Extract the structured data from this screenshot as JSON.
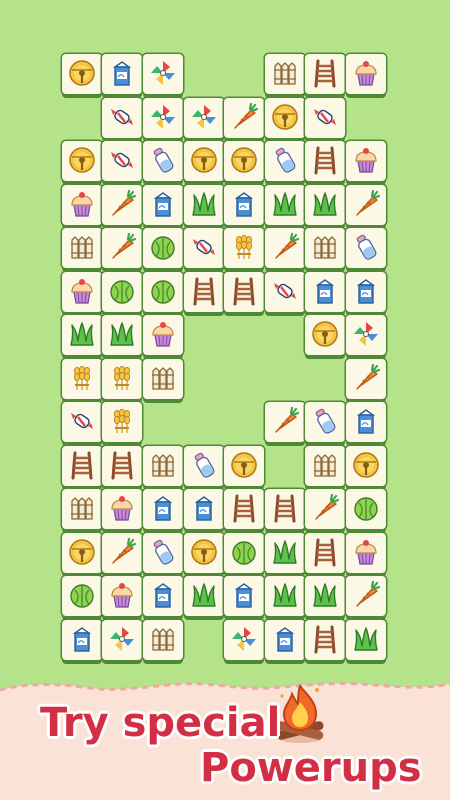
{
  "promo": {
    "line1": "Try special",
    "line2": "Powerups",
    "powerup_icon": "campfire-icon"
  },
  "board": {
    "rows": [
      [
        "bell",
        "milk",
        "pinwheel",
        null,
        null,
        null,
        "fence",
        "ladder",
        "cupcake"
      ],
      [
        null,
        "candy",
        "pinwheel",
        "pinwheel",
        "carrot",
        "bell",
        "candy",
        null,
        null
      ],
      [
        "bell",
        "candy",
        "bottle",
        "bell",
        "bell",
        "bottle",
        "ladder",
        "cupcake",
        null
      ],
      [
        "cupcake",
        "carrot",
        "milk",
        "grass",
        "milk",
        "grass",
        "grass",
        "carrot",
        null
      ],
      [
        "fence",
        "carrot",
        "cabbage",
        "candy",
        "wheat",
        "carrot",
        "fence",
        "bottle",
        null
      ],
      [
        "cupcake",
        "cabbage",
        "cabbage",
        "ladder",
        "ladder",
        "candy",
        "milk",
        "milk",
        null
      ],
      [
        "grass",
        "grass",
        "cupcake",
        null,
        null,
        null,
        "bell",
        "pinwheel",
        null
      ],
      [
        "wheat",
        "wheat",
        "fence",
        null,
        null,
        null,
        null,
        "carrot",
        null
      ],
      [
        "candy",
        "wheat",
        null,
        null,
        null,
        "carrot",
        "bottle",
        "milk",
        null
      ],
      [
        "ladder",
        "ladder",
        "fence",
        "bottle",
        "bell",
        null,
        "fence",
        "bell",
        null
      ],
      [
        "fence",
        "cupcake",
        "milk",
        "milk",
        "ladder",
        "ladder",
        "carrot",
        "cabbage",
        null
      ],
      [
        "bell",
        "carrot",
        "bottle",
        "bell",
        "cabbage",
        "grass",
        "ladder",
        "cupcake",
        null
      ],
      [
        "cabbage",
        "cupcake",
        "milk",
        "grass",
        "milk",
        "grass",
        "grass",
        "carrot",
        null
      ],
      [
        "milk",
        "pinwheel",
        "fence",
        null,
        "pinwheel",
        "milk",
        "ladder",
        "grass",
        null
      ]
    ]
  },
  "colors": {
    "background": "#b5e38a",
    "tile_face": "#fbf9e6",
    "tile_edge": "#4e8a36",
    "title_text": "#d22f45",
    "banner": "#fbe2d6",
    "banner_edge": "#f0a7a7"
  }
}
